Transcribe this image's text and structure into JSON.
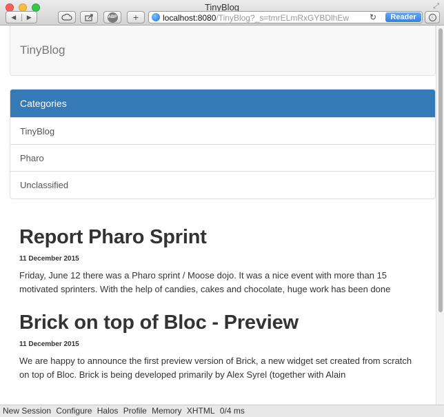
{
  "window": {
    "title": "TinyBlog"
  },
  "toolbar": {
    "back_icon": "back-arrow-icon",
    "forward_icon": "forward-arrow-icon",
    "icloud_icon": "cloud-icon",
    "share_icon": "share-icon",
    "adblock_label": "ABP",
    "new_tab_label": "+",
    "url_host": "localhost:8080",
    "url_path": "/TinyBlog?_s=tmrELmRxGYBDlhEw",
    "reload_icon": "reload-icon",
    "reader_label": "Reader",
    "download_icon": "download-icon"
  },
  "navbar": {
    "brand": "TinyBlog"
  },
  "categories": {
    "heading": "Categories",
    "items": [
      "TinyBlog",
      "Pharo",
      "Unclassified"
    ]
  },
  "posts": [
    {
      "title": "Report Pharo Sprint",
      "date": "11 December 2015",
      "body": "Friday, June 12 there was a Pharo sprint / Moose dojo. It was a nice event with more than 15 motivated sprinters. With the help of candies, cakes and chocolate, huge work has been done"
    },
    {
      "title": "Brick on top of Bloc - Preview",
      "date": "11 December 2015",
      "body": "We are happy to announce the first preview version of Brick, a new widget set created from scratch on top of Bloc. Brick is being developed primarily by Alex Syrel (together with Alain"
    }
  ],
  "seaside_toolbar": {
    "links": [
      "New Session",
      "Configure",
      "Halos",
      "Profile",
      "Memory",
      "XHTML"
    ],
    "timing": "0/4 ms"
  },
  "colors": {
    "panel_heading": "#337ab7",
    "reader_button": "#2f7fe0"
  }
}
